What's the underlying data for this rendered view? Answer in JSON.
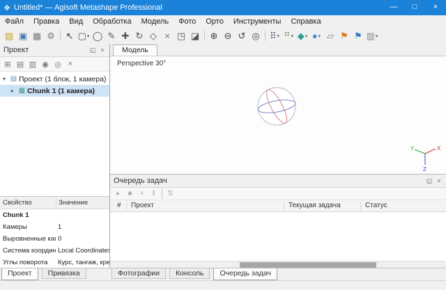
{
  "colors": {
    "titlebar": "#1a82d8",
    "selection": "#cfe3f7",
    "axis_x": "#cc3333",
    "axis_y": "#33a033",
    "axis_z": "#3344cc",
    "sphere_outline": "#b4b8c4",
    "sphere_meridian_blue": "#7585cc",
    "sphere_meridian_red": "#cc8585"
  },
  "window": {
    "title": "Untitled* — Agisoft Metashape Professional",
    "app_icon": "❖",
    "controls": {
      "minimize": "—",
      "maximize": "□",
      "close": "×"
    }
  },
  "menu": {
    "items": [
      "Файл",
      "Правка",
      "Вид",
      "Обработка",
      "Модель",
      "Фото",
      "Орто",
      "Инструменты",
      "Справка"
    ]
  },
  "toolbar": {
    "caret": "▾",
    "buttons": [
      {
        "name": "open-project",
        "glyph": "▨"
      },
      {
        "name": "save-project",
        "glyph": "▣"
      },
      {
        "name": "capture-view",
        "glyph": "▦"
      },
      {
        "name": "preferences",
        "glyph": "⚙"
      },
      {
        "name": "selection-arrow",
        "glyph": "↖"
      },
      {
        "name": "rect-selection",
        "glyph": "▢"
      },
      {
        "name": "circle-selection",
        "glyph": "◯"
      },
      {
        "name": "free-form-selection",
        "glyph": "✎"
      },
      {
        "name": "move-region",
        "glyph": "✚"
      },
      {
        "name": "rotate-region",
        "glyph": "↻"
      },
      {
        "name": "resize-region",
        "glyph": "◇"
      },
      {
        "name": "delete-selection",
        "glyph": "×"
      },
      {
        "name": "crop-selection",
        "glyph": "◳"
      },
      {
        "name": "eraser",
        "glyph": "◪"
      },
      {
        "name": "zoom-in",
        "glyph": "⊕"
      },
      {
        "name": "zoom-out",
        "glyph": "⊖"
      },
      {
        "name": "reset-view",
        "glyph": "↺"
      },
      {
        "name": "navigation",
        "glyph": "◎"
      },
      {
        "name": "point-cloud",
        "glyph": "⠿"
      },
      {
        "name": "dense-cloud",
        "glyph": "⠛"
      },
      {
        "name": "model-mesh",
        "glyph": "◆"
      },
      {
        "name": "model-shaded",
        "glyph": "●"
      },
      {
        "name": "shapes",
        "glyph": "▱"
      },
      {
        "name": "markers-flag",
        "glyph": "⚑"
      },
      {
        "name": "photos-flag",
        "glyph": "⚑"
      },
      {
        "name": "orthomosaic",
        "glyph": "▥"
      }
    ]
  },
  "project_panel": {
    "title": "Проект",
    "header_icons": {
      "float": "◱",
      "close": "×"
    },
    "toolbar_icons": [
      {
        "name": "add-chunk",
        "glyph": "⊞"
      },
      {
        "name": "add-photos",
        "glyph": "▤"
      },
      {
        "name": "add-folder",
        "glyph": "▥"
      },
      {
        "name": "enable-item",
        "glyph": "◉"
      },
      {
        "name": "disable-item",
        "glyph": "◎"
      },
      {
        "name": "remove-item",
        "glyph": "×"
      }
    ],
    "tree": {
      "root_caret": "▾",
      "root_icon": "▤",
      "root_label": "Проект (1 блок, 1 камера)",
      "chunk_caret": "▸",
      "chunk_icon": "▦",
      "chunk_label": "Chunk 1 (1 камера)"
    },
    "properties": {
      "col_property": "Свойство",
      "col_value": "Значение",
      "group_label": "Chunk 1",
      "rows": [
        {
          "name": "Камеры",
          "value": "1"
        },
        {
          "name": "Выровненные камеры",
          "value": "0"
        },
        {
          "name": "Система координат",
          "value": "Local Coordinates (m)"
        },
        {
          "name": "Углы поворота",
          "value": "Курс, тангаж, крен"
        }
      ]
    }
  },
  "viewport": {
    "tab_label": "Модель",
    "perspective_label": "Perspective 30°",
    "axes": {
      "x": "X",
      "y": "Y",
      "z": "Z"
    }
  },
  "task_queue": {
    "title": "Очередь задач",
    "header_icons": {
      "float": "◱",
      "close": "×"
    },
    "toolbar_icons": [
      {
        "name": "run-tasks",
        "glyph": "▸"
      },
      {
        "name": "stop-tasks",
        "glyph": "■"
      },
      {
        "name": "remove-task",
        "glyph": "×"
      },
      {
        "name": "pause-tasks",
        "glyph": "‖"
      },
      {
        "name": "reorder-tasks",
        "glyph": "⇅"
      }
    ],
    "columns": {
      "num": "#",
      "project": "Проект",
      "current_task": "Текущая задача",
      "status": "Статус"
    }
  },
  "bottom_tabs": {
    "left": [
      "Проект",
      "Привязка"
    ],
    "right": [
      "Фотографии",
      "Консоль",
      "Очередь задач"
    ]
  }
}
